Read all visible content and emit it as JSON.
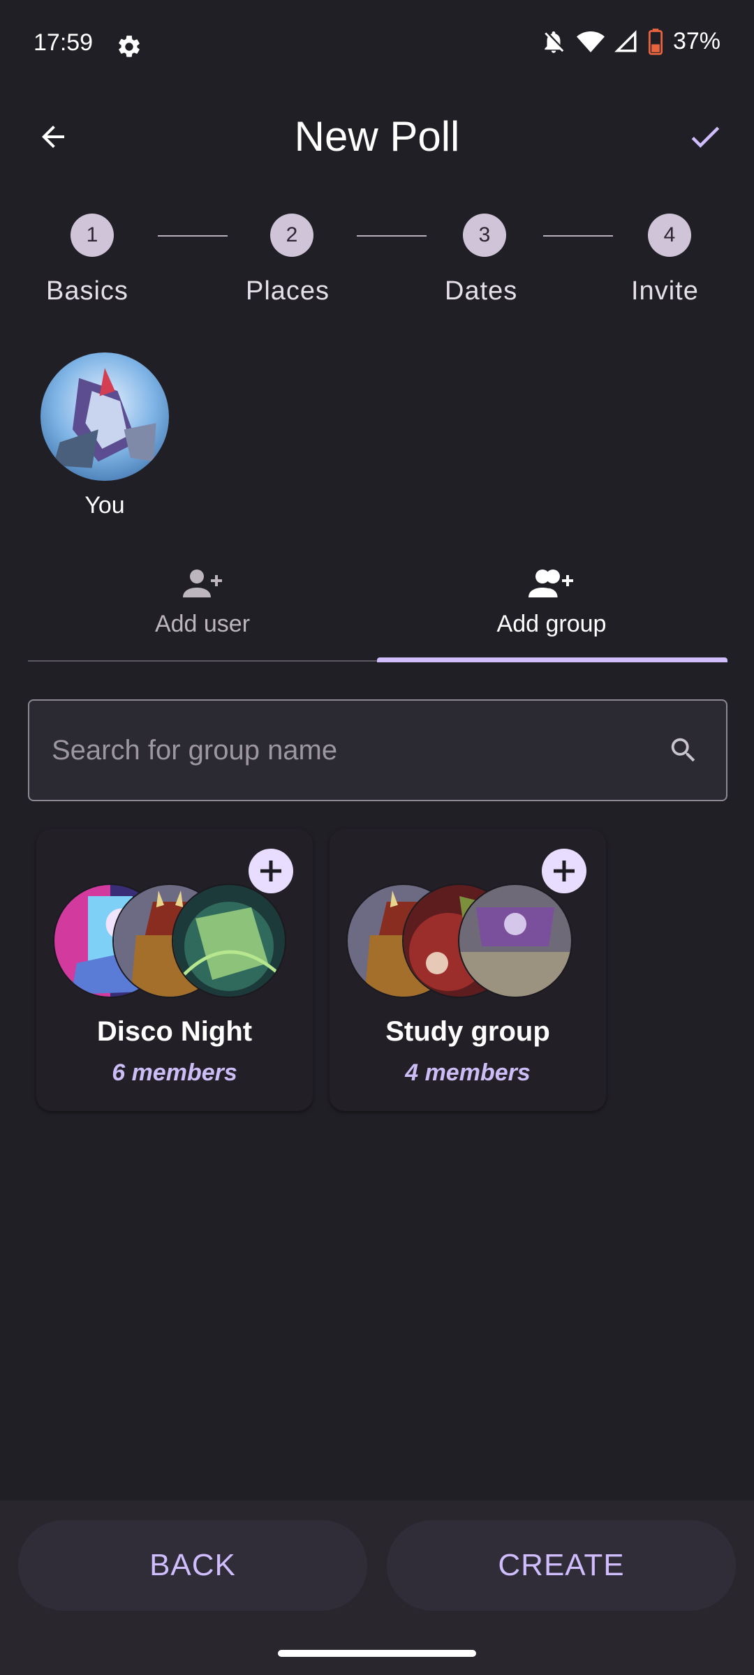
{
  "status": {
    "time": "17:59",
    "battery": "37%"
  },
  "appbar": {
    "title": "New Poll"
  },
  "stepper": {
    "steps": [
      {
        "number": "1",
        "label": "Basics"
      },
      {
        "number": "2",
        "label": "Places"
      },
      {
        "number": "3",
        "label": "Dates"
      },
      {
        "number": "4",
        "label": "Invite"
      }
    ]
  },
  "invitees": {
    "you_label": "You"
  },
  "tabs": {
    "add_user": "Add user",
    "add_group": "Add group"
  },
  "search": {
    "placeholder": "Search for group name"
  },
  "groups": [
    {
      "name": "Disco Night",
      "members": "6 members"
    },
    {
      "name": "Study group",
      "members": "4 members"
    }
  ],
  "buttons": {
    "back": "BACK",
    "create": "CREATE"
  },
  "colors": {
    "accent": "#cfbdfd",
    "background": "#211f26",
    "step_circle": "#d0c4d8"
  }
}
